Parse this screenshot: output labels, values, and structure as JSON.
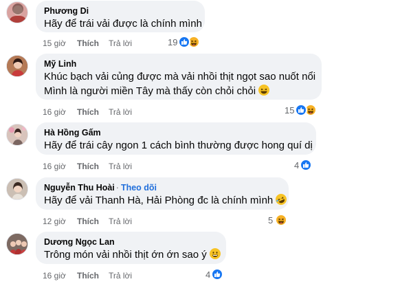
{
  "comments": [
    {
      "name": "Phương Di",
      "follow": "",
      "lines": [
        "Hãy để trái vải được là chính mình"
      ],
      "time": "15 giờ",
      "like_label": "Thích",
      "reply_label": "Trả lời",
      "reaction_count": "19",
      "reactions": [
        "like-reaction-icon",
        "haha-reaction-icon"
      ],
      "avatar_color": "#d9a3a0"
    },
    {
      "name": "Mỹ Linh",
      "follow": "",
      "lines": [
        "Khúc bạch vải củng được mà vải nhồi thịt ngọt sao nuốt nổi",
        "Mình là người miền Tây mà thấy còn chỏi chỏi"
      ],
      "time": "16 giờ",
      "like_label": "Thích",
      "reply_label": "Trả lời",
      "reaction_count": "15",
      "reactions": [
        "like-reaction-icon",
        "haha-reaction-icon"
      ],
      "avatar_color": "#8a4b3a"
    },
    {
      "name": "Hà Hồng Gấm",
      "follow": "",
      "lines": [
        "Hãy để trái cây ngon 1 cách bình thường được hong quí dị"
      ],
      "time": "16 giờ",
      "like_label": "Thích",
      "reply_label": "Trả lời",
      "reaction_count": "4",
      "reactions": [
        "like-reaction-icon"
      ],
      "avatar_color": "#c7b0a8"
    },
    {
      "name": "Nguyễn Thu Hoài",
      "follow": "Theo dõi",
      "lines": [
        "Hãy để vải Thanh Hà, Hải Phòng đc là chính mình"
      ],
      "time": "12 giờ",
      "like_label": "Thích",
      "reply_label": "Trả lời",
      "reaction_count": "5",
      "reactions": [
        "haha-reaction-icon"
      ],
      "avatar_color": "#a88e7e"
    },
    {
      "name": "Dương Ngọc Lan",
      "follow": "",
      "lines": [
        "Trông món vải nhồi thịt ớn ớn sao ý"
      ],
      "time": "16 giờ",
      "like_label": "Thích",
      "reply_label": "Trả lời",
      "reaction_count": "4",
      "reactions": [
        "like-reaction-icon"
      ],
      "avatar_color": "#6b5a55"
    }
  ],
  "colors": {
    "bubble": "#f0f2f5",
    "like_blue": "#1877f2",
    "haha_yellow": "#f7b125",
    "meta_gray": "#65676b",
    "follow_blue": "#216fdb"
  }
}
